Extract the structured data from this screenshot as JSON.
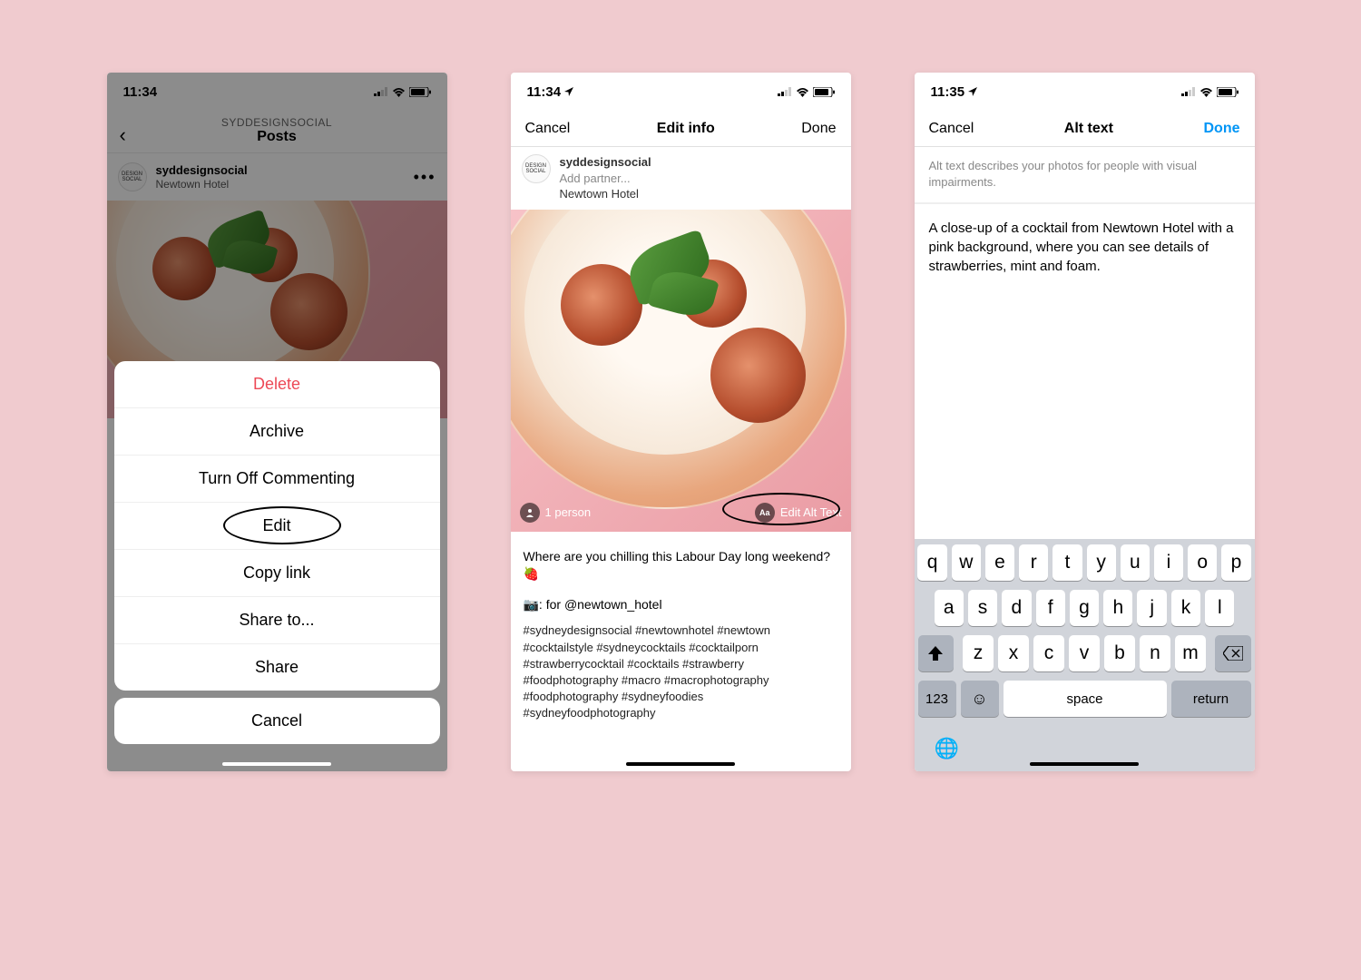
{
  "phone1": {
    "time": "11:34",
    "header_sub": "SYDDESIGNSOCIAL",
    "header_main": "Posts",
    "author_name": "syddesignsocial",
    "author_location": "Newtown Hotel",
    "avatar_text": "DESIGN\nSOCIAL",
    "sheet": {
      "delete": "Delete",
      "archive": "Archive",
      "turn_off": "Turn Off Commenting",
      "edit": "Edit",
      "copy_link": "Copy link",
      "share_to": "Share to...",
      "share": "Share",
      "cancel": "Cancel"
    }
  },
  "phone2": {
    "time": "11:34",
    "nav_cancel": "Cancel",
    "nav_title": "Edit info",
    "nav_done": "Done",
    "author_name": "syddesignsocial",
    "add_partner": "Add partner...",
    "author_location": "Newtown Hotel",
    "tag_people": "1 person",
    "edit_alt": "Edit Alt Text",
    "alt_icon_label": "Aa",
    "caption_line1": "Where are you chilling this Labour Day long weekend? 🍓",
    "caption_line2": "📷: for @newtown_hotel",
    "hashtags": "#sydneydesignsocial #newtownhotel #newtown #cocktailstyle #sydneycocktails #cocktailporn #strawberrycocktail #cocktails #strawberry #foodphotography #macro #macrophotography #foodphotography #sydneyfoodies #sydneyfoodphotography"
  },
  "phone3": {
    "time": "11:35",
    "nav_cancel": "Cancel",
    "nav_title": "Alt text",
    "nav_done": "Done",
    "hint": "Alt text describes your photos for people with visual impairments.",
    "alt_text": "A close-up of a cocktail from Newtown Hotel with a pink background, where you can see details of strawberries, mint and foam.",
    "keyboard": {
      "row1": [
        "q",
        "w",
        "e",
        "r",
        "t",
        "y",
        "u",
        "i",
        "o",
        "p"
      ],
      "row2": [
        "a",
        "s",
        "d",
        "f",
        "g",
        "h",
        "j",
        "k",
        "l"
      ],
      "row3": [
        "z",
        "x",
        "c",
        "v",
        "b",
        "n",
        "m"
      ],
      "num": "123",
      "space": "space",
      "return": "return"
    }
  }
}
